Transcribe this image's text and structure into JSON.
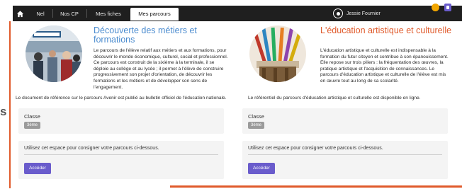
{
  "nav": {
    "tabs": [
      {
        "label": "Nel"
      },
      {
        "label": "Nos CP"
      },
      {
        "label": "Mes fiches"
      },
      {
        "label": "Mes parcours"
      }
    ],
    "active_tab": 3,
    "user_name": "Jessie Fournier"
  },
  "side_label": "s",
  "cards": [
    {
      "title": "Découverte des métiers et formations",
      "description": "Le parcours de l'élève relatif aux métiers et aux formations, pour découvrir le monde économique, culturel, social et professionnel. Ce parcours est construit de la sixième à la terminale, il se déploie au collège et au lycée ; il permet à l'élève de construire progressivement son projet d'orientation, de découvrir les formations et les métiers et de développer son sens de l'engagement.",
      "tail": "Le document de référence sur le parcours Avenir est publié au bulletin officiel de l'éducation nationale.",
      "classe_label": "Classe",
      "classe_value": "3ème",
      "info_text": "Utilisez cet espace pour consigner votre parcours ci-dessous.",
      "button_label": "Accéder"
    },
    {
      "title": "L'éducation artistique et culturelle",
      "description": "L'éducation artistique et culturelle est indispensable à la formation du futur citoyen et contribue à son épanouissement. Elle repose sur trois piliers : la fréquentation des œuvres, la pratique artistique et l'acquisition de connaissances. Le parcours d'éducation artistique et culturelle de l'élève est mis en œuvre tout au long de sa scolarité.",
      "tail": "Le référentiel du parcours d'éducation artistique et culturelle est disponible en ligne.",
      "classe_label": "Classe",
      "classe_value": "3ème",
      "info_text": "Utilisez cet espace pour consigner votre parcours ci-dessous.",
      "button_label": "Accéder"
    }
  ],
  "colors": {
    "nav_bg": "#1f1f1f",
    "title_blue": "#4a8bcf",
    "title_orange": "#e05a2b",
    "button_purple": "#6a5ccc",
    "accent_orange": "#e05a2b",
    "notif_yellow": "#f2a600",
    "panel_bg": "#f4f4f4"
  },
  "icons": [
    "home-icon",
    "user-icon",
    "notification-icon",
    "settings-icon"
  ]
}
